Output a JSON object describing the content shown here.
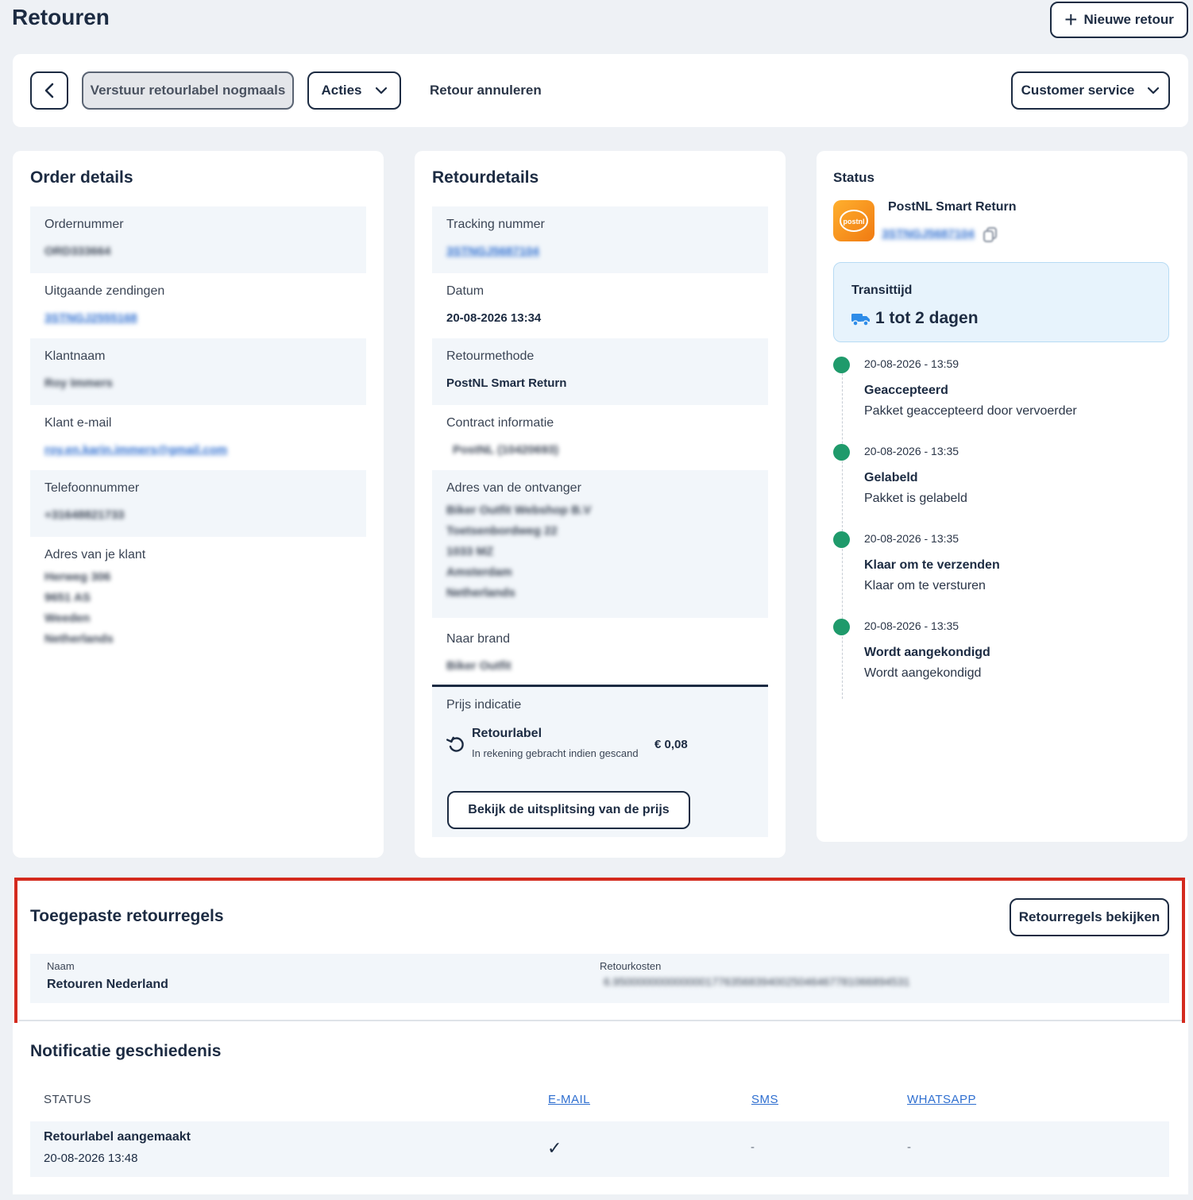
{
  "page": {
    "title": "Retouren",
    "new_return_label": "Nieuwe retour"
  },
  "toolbar": {
    "resend_label": "Verstuur retourlabel nogmaals",
    "actions_label": "Acties",
    "cancel_label": "Retour annuleren",
    "customer_service_label": "Customer service"
  },
  "order_details": {
    "title": "Order details",
    "fields": [
      {
        "label": "Ordernummer",
        "value": "ORD333664"
      },
      {
        "label": "Uitgaande zendingen",
        "value": "3STNGJ2555168"
      },
      {
        "label": "Klantnaam",
        "value": "Roy Immers"
      },
      {
        "label": "Klant e-mail",
        "value": "roy.en.karin.immers@gmail.com"
      },
      {
        "label": "Telefoonnummer",
        "value": "+31648821733"
      },
      {
        "label": "Adres van je klant",
        "lines": [
          "Herweg 306",
          "9651 AS",
          "Weeden",
          "Netherlands"
        ]
      }
    ]
  },
  "return_details": {
    "title": "Retourdetails",
    "fields": [
      {
        "label": "Tracking nummer",
        "value": "3STNGJ5687104"
      },
      {
        "label": "Datum",
        "value": "20-08-2026 13:34"
      },
      {
        "label": "Retourmethode",
        "value": "PostNL Smart Return"
      },
      {
        "label": "Contract informatie",
        "value": "PostNL (10420693)"
      },
      {
        "label": "Adres van de ontvanger",
        "lines": [
          "Biker Outfit Webshop B.V",
          "Toetsenbordweg 22",
          "1033 MZ",
          "Amsterdam",
          "Netherlands"
        ]
      },
      {
        "label": "Naar brand",
        "value": "Biker Outfit"
      }
    ],
    "price": {
      "label": "Prijs indicatie",
      "item_title": "Retourlabel",
      "item_sub": "In rekening gebracht indien gescand",
      "amount": "€ 0,08",
      "breakdown_label": "Bekijk de uitsplitsing van de prijs"
    }
  },
  "status": {
    "title": "Status",
    "carrier_name": "PostNL Smart Return",
    "carrier_tracking": "3STNGJ5687104",
    "logo_text": "postnl",
    "transit_label": "Transittijd",
    "transit_value": "1 tot 2 dagen",
    "timeline": [
      {
        "time": "20-08-2026 - 13:59",
        "title": "Geaccepteerd",
        "desc": "Pakket geaccepteerd door vervoerder"
      },
      {
        "time": "20-08-2026 - 13:35",
        "title": "Gelabeld",
        "desc": "Pakket is gelabeld"
      },
      {
        "time": "20-08-2026 - 13:35",
        "title": "Klaar om te verzenden",
        "desc": "Klaar om te versturen"
      },
      {
        "time": "20-08-2026 - 13:35",
        "title": "Wordt aangekondigd",
        "desc": "Wordt aangekondigd"
      }
    ]
  },
  "rules": {
    "title": "Toegepaste retourregels",
    "button_label": "Retourregels bekijken",
    "name_header": "Naam",
    "cost_header": "Retourkosten",
    "name_value": "Retouren Nederland",
    "cost_value": "6.950000000000000177635683940025046467781066894531"
  },
  "notifications": {
    "title": "Notificatie geschiedenis",
    "headers": [
      "STATUS",
      "E-MAIL",
      "SMS",
      "WHATSAPP"
    ],
    "rows": [
      {
        "status": "Retourlabel aangemaakt",
        "date": "20-08-2026 13:48",
        "email": "✓",
        "sms": "-",
        "whatsapp": "-"
      }
    ]
  },
  "colors": {
    "navy": "#1c2b42",
    "status_green": "#1f9a6b",
    "link_blue": "#2f6fd0",
    "highlight_red": "#d42a1e",
    "postnl_orange": "#f59a1c"
  }
}
